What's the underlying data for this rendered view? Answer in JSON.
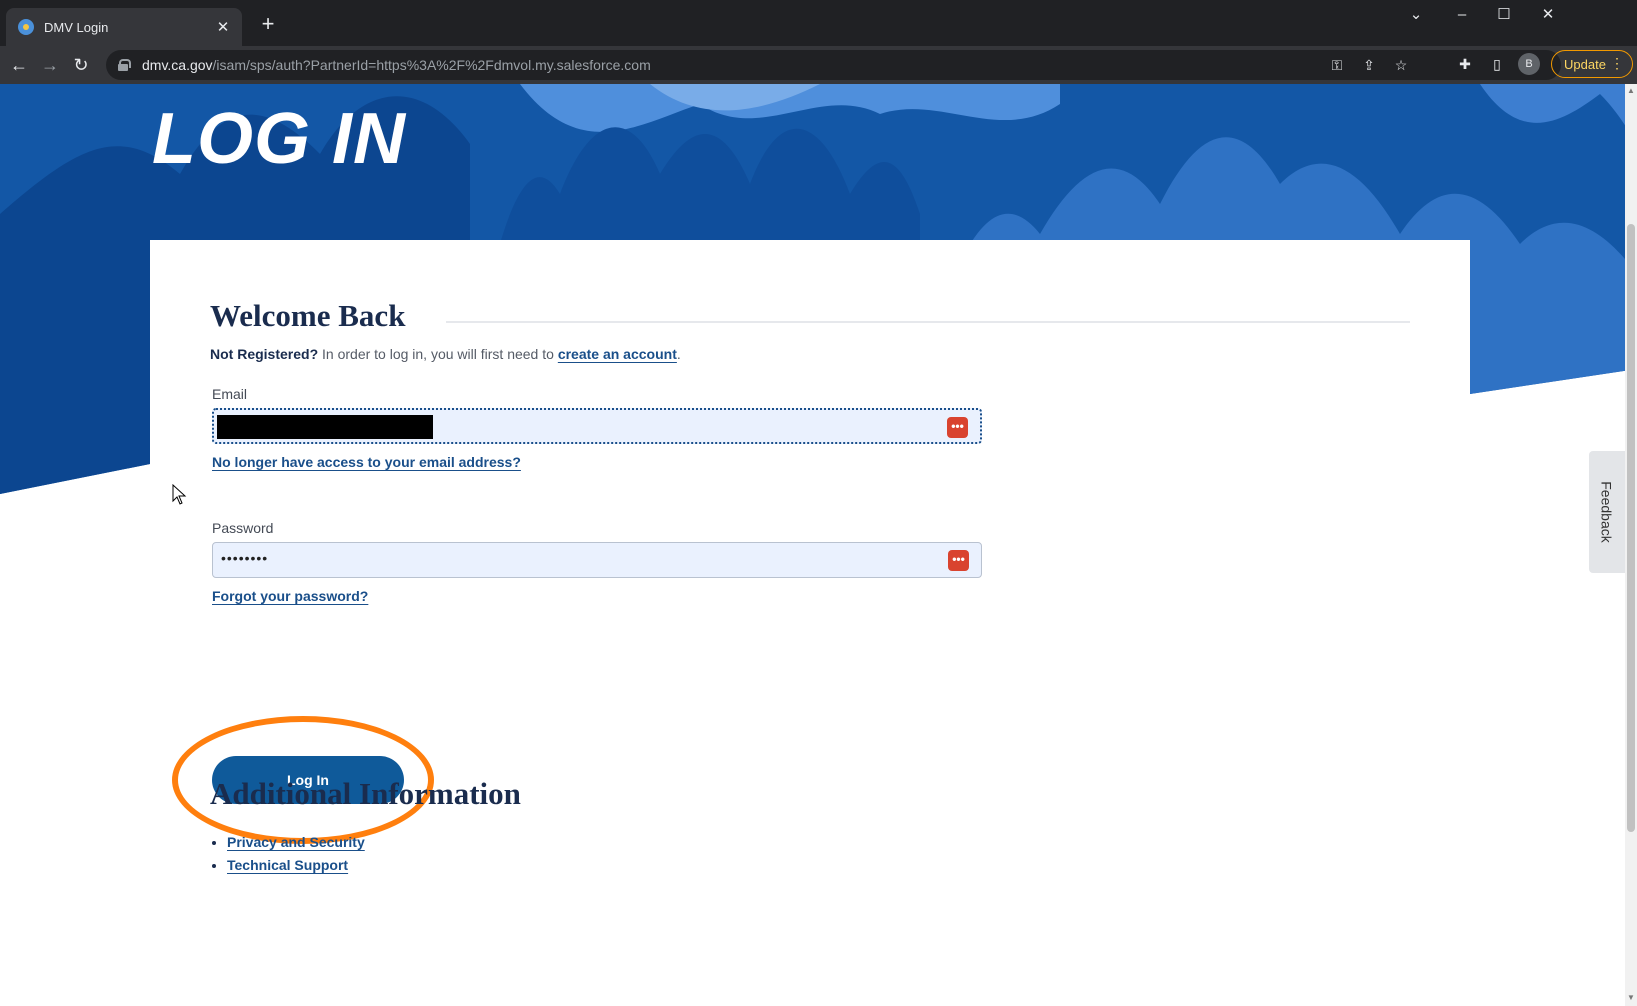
{
  "browser": {
    "tab_title": "DMV Login",
    "url_host": "dmv.ca.gov",
    "url_path": "/isam/sps/auth?PartnerId=https%3A%2F%2Fdmvol.my.salesforce.com",
    "profile_initial": "B",
    "update_label": "Update"
  },
  "page": {
    "title": "LOG IN",
    "welcome_heading": "Welcome Back",
    "not_registered_bold": "Not Registered?",
    "not_registered_text": " In order to log in, you will first need to ",
    "create_account_link": "create an account",
    "period": ".",
    "email_label": "Email",
    "email_help_link": "No longer have access to your email address?",
    "password_label": "Password",
    "password_value": "••••••••",
    "forgot_password_link": "Forgot your password?",
    "login_button": "Log In",
    "additional_heading": "Additional Information",
    "additional_links": [
      "Privacy and Security",
      "Technical Support"
    ],
    "feedback_tab": "Feedback"
  },
  "colors": {
    "brand_blue": "#0f5a9a",
    "heading_navy": "#1a2c4e",
    "highlight_orange": "#ff7f0e"
  }
}
